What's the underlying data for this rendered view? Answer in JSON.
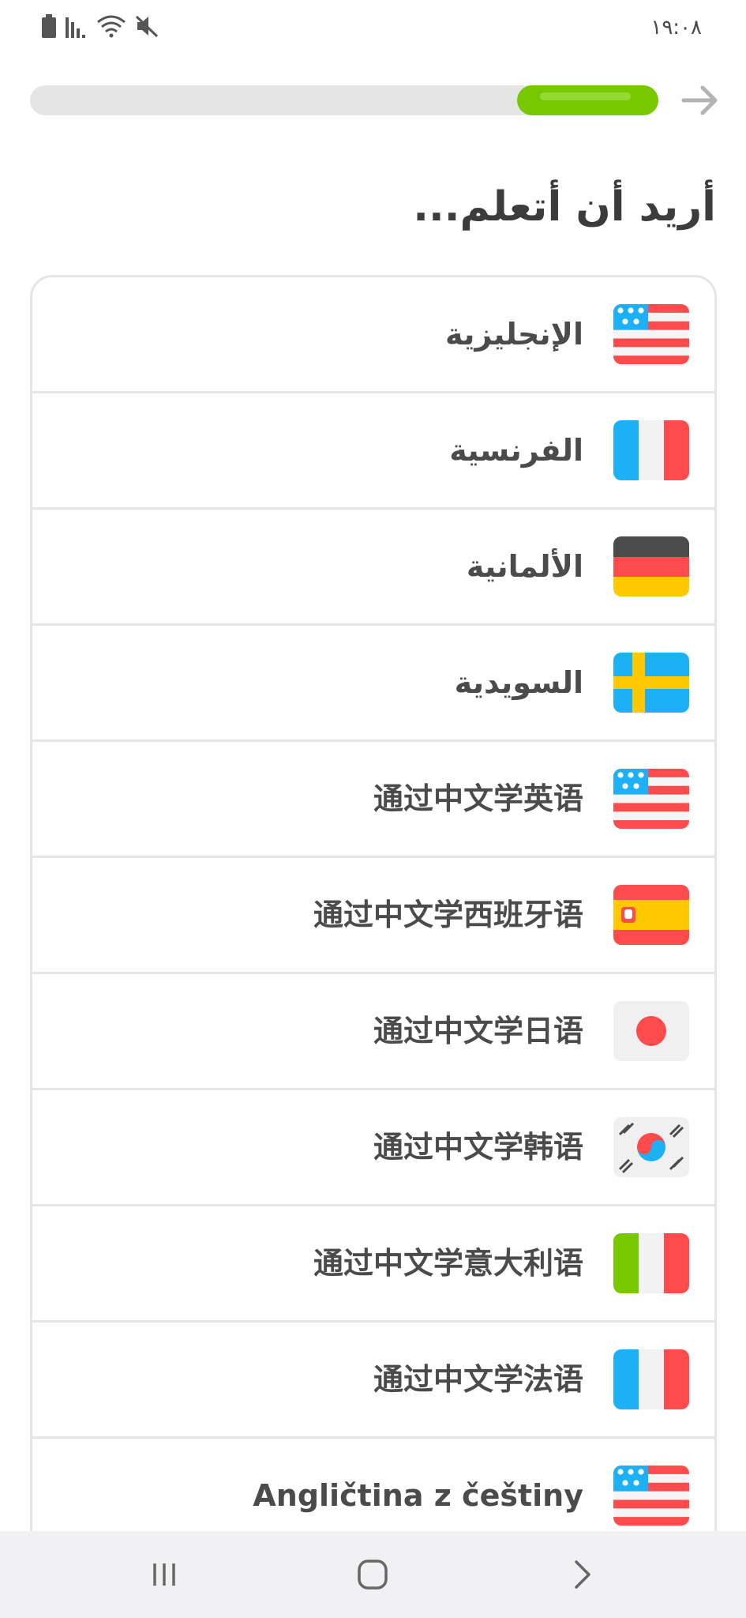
{
  "status_bar": {
    "time": "١٩:٠٨",
    "icons": [
      "battery-icon",
      "signal-icon",
      "wifi-icon",
      "mute-icon"
    ]
  },
  "progress": {
    "value": 0.25,
    "fill_color": "#78c800",
    "track_color": "#e5e5e5"
  },
  "title": "أريد أن أتعلم...",
  "languages": [
    {
      "label": "الإنجليزية",
      "flag": "us-flag-icon",
      "rtl": true
    },
    {
      "label": "الفرنسية",
      "flag": "france-flag-icon",
      "rtl": true
    },
    {
      "label": "الألمانية",
      "flag": "germany-flag-icon",
      "rtl": true
    },
    {
      "label": "السويدية",
      "flag": "sweden-flag-icon",
      "rtl": true
    },
    {
      "label": "通过中文学英语",
      "flag": "us-flag-icon",
      "rtl": false
    },
    {
      "label": "通过中文学西班牙语",
      "flag": "spain-flag-icon",
      "rtl": false
    },
    {
      "label": "通过中文学日语",
      "flag": "japan-flag-icon",
      "rtl": false
    },
    {
      "label": "通过中文学韩语",
      "flag": "korea-flag-icon",
      "rtl": false
    },
    {
      "label": "通过中文学意大利语",
      "flag": "italy-flag-icon",
      "rtl": false
    },
    {
      "label": "通过中文学法语",
      "flag": "france-flag-icon",
      "rtl": false
    },
    {
      "label": "Angličtina z češtiny",
      "flag": "us-flag-icon",
      "rtl": false
    }
  ],
  "colors": {
    "accent_green": "#78c800",
    "text": "#4b4b4b",
    "border": "#e5e5e5"
  },
  "nav": [
    "recent-apps-icon",
    "home-icon",
    "back-icon"
  ]
}
